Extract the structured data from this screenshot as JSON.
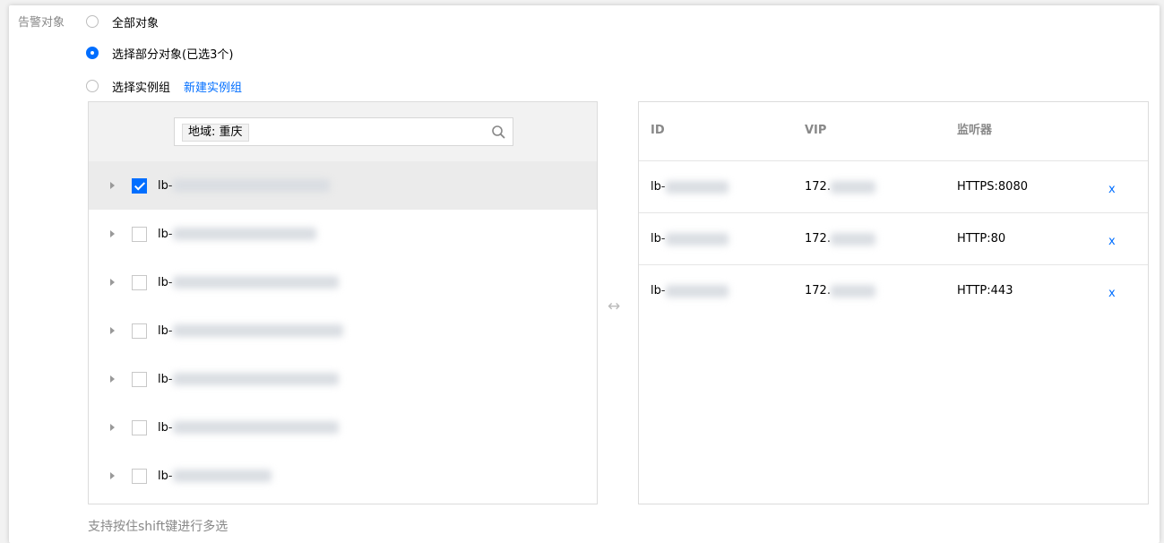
{
  "field_label": "告警对象",
  "radios": [
    {
      "label": "全部对象",
      "checked": false
    },
    {
      "label": "选择部分对象(已选3个)",
      "checked": true
    },
    {
      "label": "选择实例组",
      "checked": false
    }
  ],
  "new_group_link": "新建实例组",
  "search": {
    "tag": "地域: 重庆",
    "icon": "search-icon"
  },
  "tree_items": [
    {
      "prefix": "lb-",
      "checked": true
    },
    {
      "prefix": "lb-",
      "checked": false
    },
    {
      "prefix": "lb-",
      "checked": false
    },
    {
      "prefix": "lb-",
      "checked": false
    },
    {
      "prefix": "lb-",
      "checked": false
    },
    {
      "prefix": "lb-",
      "checked": false
    },
    {
      "prefix": "lb-",
      "checked": false
    }
  ],
  "swap_icon": "↔",
  "selected_table": {
    "headers": {
      "id": "ID",
      "vip": "VIP",
      "listener": "监听器"
    },
    "rows": [
      {
        "id": "lb-",
        "vip": "172.",
        "listener": "HTTPS:8080",
        "remove": "x"
      },
      {
        "id": "lb-",
        "vip": "172.",
        "listener": "HTTP:80",
        "remove": "x"
      },
      {
        "id": "lb-",
        "vip": "172.",
        "listener": "HTTP:443",
        "remove": "x"
      }
    ]
  },
  "hint": "支持按住shift键进行多选",
  "colors": {
    "accent": "#006eff",
    "muted": "#888888"
  }
}
